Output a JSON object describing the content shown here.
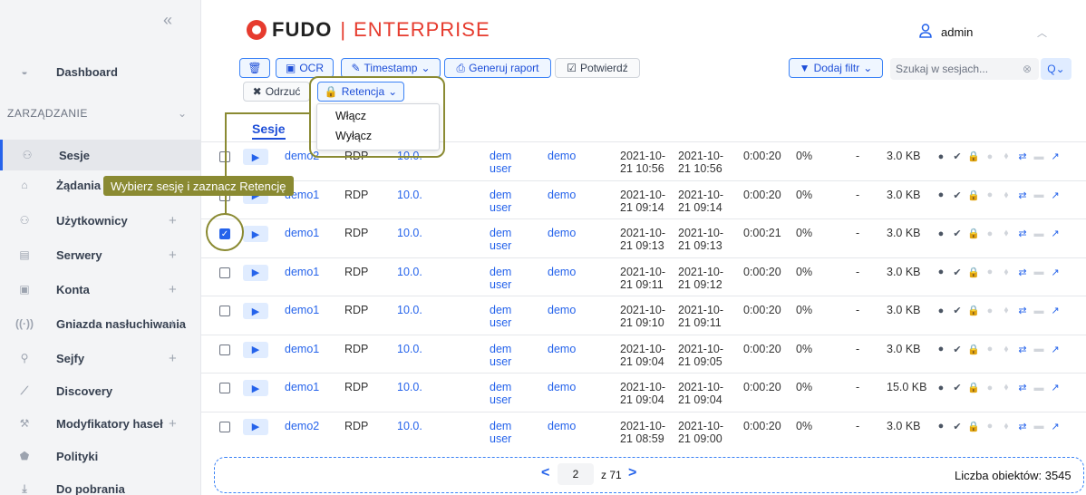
{
  "sidebar": {
    "collapse_icon": "«",
    "section_label": "ZARZĄDZANIE",
    "items": [
      {
        "label": "Dashboard",
        "icon": "dashboard-icon",
        "has_plus": false
      },
      {
        "label": "Sesje",
        "icon": "sessions-icon",
        "has_plus": false,
        "active": true
      },
      {
        "label": "Żądania",
        "icon": "requests-icon",
        "has_plus": false
      },
      {
        "label": "Użytkownicy",
        "icon": "users-icon",
        "has_plus": true
      },
      {
        "label": "Serwery",
        "icon": "servers-icon",
        "has_plus": true
      },
      {
        "label": "Konta",
        "icon": "accounts-icon",
        "has_plus": true
      },
      {
        "label": "Gniazda nasłuchiwania",
        "icon": "listeners-icon",
        "has_plus": true
      },
      {
        "label": "Sejfy",
        "icon": "safes-icon",
        "has_plus": true
      },
      {
        "label": "Discovery",
        "icon": "discovery-icon",
        "has_plus": false
      },
      {
        "label": "Modyfikatory haseł",
        "icon": "password-modifiers-icon",
        "has_plus": true
      },
      {
        "label": "Polityki",
        "icon": "policies-icon",
        "has_plus": false
      },
      {
        "label": "Do pobrania",
        "icon": "download-icon",
        "has_plus": false
      }
    ],
    "plus": "+"
  },
  "header": {
    "logo_word": "FUDO",
    "logo_sep": "|",
    "logo_sub": "ENTERPRISE",
    "user": "admin"
  },
  "toolbar": {
    "trash_label": "🗑",
    "ocr_label": "OCR",
    "timestamp_label": "Timestamp",
    "report_label": "Generuj raport",
    "confirm_label": "Potwierdź",
    "reject_label": "Odrzuć",
    "retention_label": "Retencja",
    "add_filter_label": "Dodaj filtr",
    "search_placeholder": "Szukaj w sesjach...",
    "search_btn": "Q"
  },
  "tab": "Sesje",
  "dropdown": {
    "items": [
      "Włącz",
      "Wyłącz"
    ]
  },
  "tooltip": "Wybierz sesję i zaznacz Retencję",
  "rows": [
    {
      "user": "demo2",
      "proto": "RDP",
      "ip": "10.0.",
      "acc": "dem",
      "acc2": "user",
      "srv": "demo",
      "start_a": "2021-10-",
      "start_b": "21 10:56",
      "end_a": "2021-10-",
      "end_b": "21 10:56",
      "dur": "0:00:20",
      "pct": "0%",
      "dash": "-",
      "size": "3.0 KB",
      "checked": false
    },
    {
      "user": "demo1",
      "proto": "RDP",
      "ip": "10.0.",
      "acc": "dem",
      "acc2": "user",
      "srv": "demo",
      "start_a": "2021-10-",
      "start_b": "21 09:14",
      "end_a": "2021-10-",
      "end_b": "21 09:14",
      "dur": "0:00:20",
      "pct": "0%",
      "dash": "-",
      "size": "3.0 KB",
      "checked": false
    },
    {
      "user": "demo1",
      "proto": "RDP",
      "ip": "10.0.",
      "acc": "dem",
      "acc2": "user",
      "srv": "demo",
      "start_a": "2021-10-",
      "start_b": "21 09:13",
      "end_a": "2021-10-",
      "end_b": "21 09:13",
      "dur": "0:00:21",
      "pct": "0%",
      "dash": "-",
      "size": "3.0 KB",
      "checked": true
    },
    {
      "user": "demo1",
      "proto": "RDP",
      "ip": "10.0.",
      "acc": "dem",
      "acc2": "user",
      "srv": "demo",
      "start_a": "2021-10-",
      "start_b": "21 09:11",
      "end_a": "2021-10-",
      "end_b": "21 09:12",
      "dur": "0:00:20",
      "pct": "0%",
      "dash": "-",
      "size": "3.0 KB",
      "checked": false
    },
    {
      "user": "demo1",
      "proto": "RDP",
      "ip": "10.0.",
      "acc": "dem",
      "acc2": "user",
      "srv": "demo",
      "start_a": "2021-10-",
      "start_b": "21 09:10",
      "end_a": "2021-10-",
      "end_b": "21 09:11",
      "dur": "0:00:20",
      "pct": "0%",
      "dash": "-",
      "size": "3.0 KB",
      "checked": false
    },
    {
      "user": "demo1",
      "proto": "RDP",
      "ip": "10.0.",
      "acc": "dem",
      "acc2": "user",
      "srv": "demo",
      "start_a": "2021-10-",
      "start_b": "21 09:04",
      "end_a": "2021-10-",
      "end_b": "21 09:05",
      "dur": "0:00:20",
      "pct": "0%",
      "dash": "-",
      "size": "3.0 KB",
      "checked": false
    },
    {
      "user": "demo1",
      "proto": "RDP",
      "ip": "10.0.",
      "acc": "dem",
      "acc2": "user",
      "srv": "demo",
      "start_a": "2021-10-",
      "start_b": "21 09:04",
      "end_a": "2021-10-",
      "end_b": "21 09:04",
      "dur": "0:00:20",
      "pct": "0%",
      "dash": "-",
      "size": "15.0 KB",
      "checked": false
    },
    {
      "user": "demo2",
      "proto": "RDP",
      "ip": "10.0.",
      "acc": "dem",
      "acc2": "user",
      "srv": "demo",
      "start_a": "2021-10-",
      "start_b": "21 08:59",
      "end_a": "2021-10-",
      "end_b": "21 09:00",
      "dur": "0:00:20",
      "pct": "0%",
      "dash": "-",
      "size": "3.0 KB",
      "checked": false
    }
  ],
  "pagination": {
    "prev": "<",
    "page": "2",
    "of": "z 71",
    "next": ">",
    "count": "Liczba obiektów: 3545"
  }
}
